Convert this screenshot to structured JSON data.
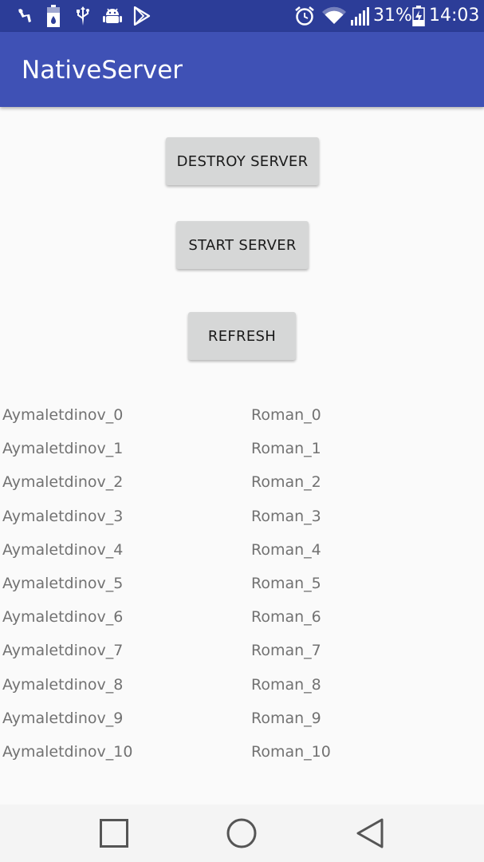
{
  "status_bar": {
    "battery_percent": "31%",
    "time": "14:03",
    "icons": [
      "notification-app-icon",
      "battery-saver-icon",
      "usb-icon",
      "android-debug-icon",
      "play-store-icon",
      "alarm-icon",
      "wifi-icon",
      "signal-icon",
      "battery-charging-icon"
    ]
  },
  "app_bar": {
    "title": "NativeServer"
  },
  "buttons": {
    "destroy": "DESTROY SERVER",
    "start": "START SERVER",
    "refresh": "REFRESH"
  },
  "list": {
    "rows": [
      {
        "left": "Aymaletdinov_0",
        "right": "Roman_0"
      },
      {
        "left": "Aymaletdinov_1",
        "right": "Roman_1"
      },
      {
        "left": "Aymaletdinov_2",
        "right": "Roman_2"
      },
      {
        "left": "Aymaletdinov_3",
        "right": "Roman_3"
      },
      {
        "left": "Aymaletdinov_4",
        "right": "Roman_4"
      },
      {
        "left": "Aymaletdinov_5",
        "right": "Roman_5"
      },
      {
        "left": "Aymaletdinov_6",
        "right": "Roman_6"
      },
      {
        "left": "Aymaletdinov_7",
        "right": "Roman_7"
      },
      {
        "left": "Aymaletdinov_8",
        "right": "Roman_8"
      },
      {
        "left": "Aymaletdinov_9",
        "right": "Roman_9"
      },
      {
        "left": "Aymaletdinov_10",
        "right": "Roman_10"
      }
    ]
  },
  "nav_bar": {
    "icons": [
      "recents-icon",
      "home-icon",
      "back-icon"
    ]
  },
  "colors": {
    "status_bar": "#2c3d98",
    "app_bar": "#3f51b5",
    "button_bg": "#d6d7d7",
    "list_text": "#727272",
    "background": "#fafafa"
  }
}
